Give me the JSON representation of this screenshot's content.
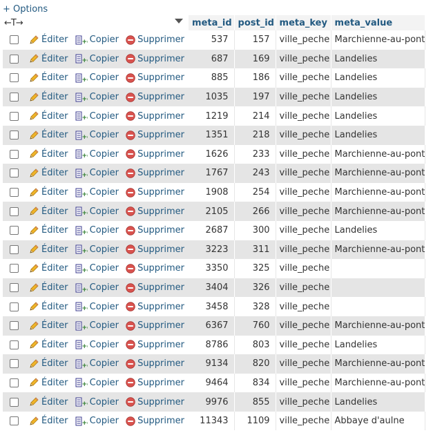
{
  "options_label": "+ Options",
  "header": {
    "arrows": "←T→",
    "meta_id": "meta_id",
    "post_id": "post_id",
    "meta_key": "meta_key",
    "meta_value": "meta_value"
  },
  "actions": {
    "edit": "Éditer",
    "copy": "Copier",
    "delete": "Supprimer"
  },
  "colors": {
    "link": "#235a81",
    "row_alt": "#e5e5e5",
    "delete_icon": "#d9534f"
  },
  "rows": [
    {
      "meta_id": "537",
      "post_id": "157",
      "meta_key": "ville_peche",
      "meta_value": "Marchienne-au-pont"
    },
    {
      "meta_id": "687",
      "post_id": "169",
      "meta_key": "ville_peche",
      "meta_value": "Landelies"
    },
    {
      "meta_id": "885",
      "post_id": "186",
      "meta_key": "ville_peche",
      "meta_value": "Landelies"
    },
    {
      "meta_id": "1035",
      "post_id": "197",
      "meta_key": "ville_peche",
      "meta_value": "Landelies"
    },
    {
      "meta_id": "1219",
      "post_id": "214",
      "meta_key": "ville_peche",
      "meta_value": "Landelies"
    },
    {
      "meta_id": "1351",
      "post_id": "218",
      "meta_key": "ville_peche",
      "meta_value": "Landelies"
    },
    {
      "meta_id": "1626",
      "post_id": "233",
      "meta_key": "ville_peche",
      "meta_value": "Marchienne-au-pont"
    },
    {
      "meta_id": "1767",
      "post_id": "243",
      "meta_key": "ville_peche",
      "meta_value": "Marchienne-au-pont"
    },
    {
      "meta_id": "1908",
      "post_id": "254",
      "meta_key": "ville_peche",
      "meta_value": "Marchienne-au-pont"
    },
    {
      "meta_id": "2105",
      "post_id": "266",
      "meta_key": "ville_peche",
      "meta_value": "Marchienne-au-pont"
    },
    {
      "meta_id": "2687",
      "post_id": "300",
      "meta_key": "ville_peche",
      "meta_value": "Landelies"
    },
    {
      "meta_id": "3223",
      "post_id": "311",
      "meta_key": "ville_peche",
      "meta_value": "Marchienne-au-pont"
    },
    {
      "meta_id": "3350",
      "post_id": "325",
      "meta_key": "ville_peche",
      "meta_value": ""
    },
    {
      "meta_id": "3404",
      "post_id": "326",
      "meta_key": "ville_peche",
      "meta_value": ""
    },
    {
      "meta_id": "3458",
      "post_id": "328",
      "meta_key": "ville_peche",
      "meta_value": ""
    },
    {
      "meta_id": "6367",
      "post_id": "760",
      "meta_key": "ville_peche",
      "meta_value": "Marchienne-au-pont"
    },
    {
      "meta_id": "8786",
      "post_id": "803",
      "meta_key": "ville_peche",
      "meta_value": "Landelies"
    },
    {
      "meta_id": "9134",
      "post_id": "820",
      "meta_key": "ville_peche",
      "meta_value": "Marchienne-au-pont"
    },
    {
      "meta_id": "9464",
      "post_id": "834",
      "meta_key": "ville_peche",
      "meta_value": "Marchienne-au-pont"
    },
    {
      "meta_id": "9976",
      "post_id": "855",
      "meta_key": "ville_peche",
      "meta_value": "Landelies"
    },
    {
      "meta_id": "11343",
      "post_id": "1109",
      "meta_key": "ville_peche",
      "meta_value": "Abbaye d'aulne"
    }
  ]
}
